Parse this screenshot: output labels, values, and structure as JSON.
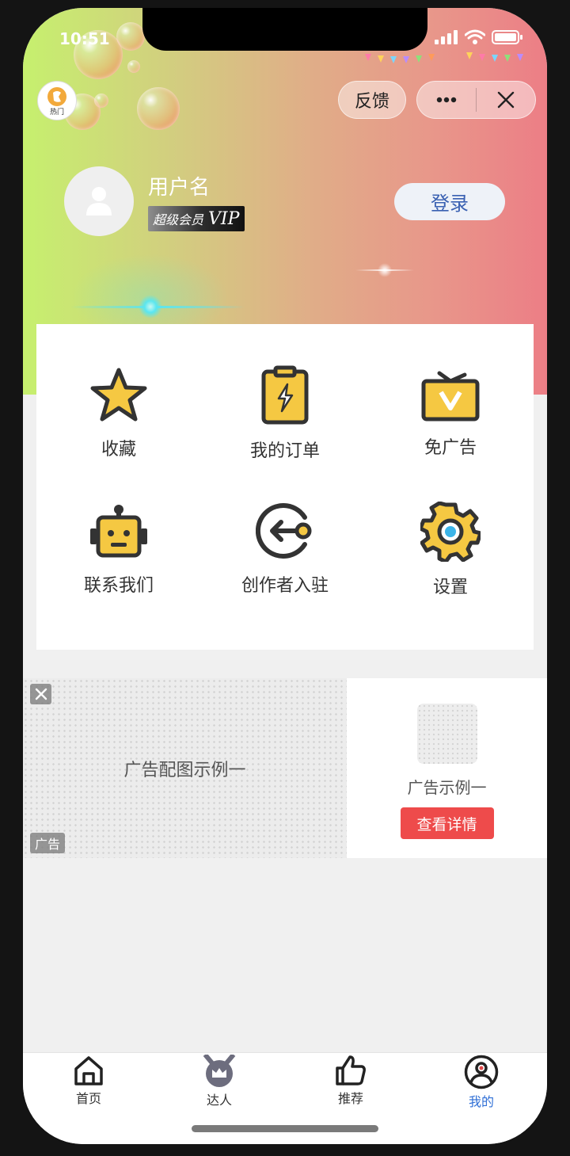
{
  "status_bar": {
    "time": "10:51"
  },
  "header": {
    "logo_text": "热门",
    "feedback_label": "反馈",
    "more_icon": "more-dots-icon",
    "close_icon": "close-icon"
  },
  "profile": {
    "username": "用户名",
    "vip_badge_cn": "超级会员",
    "vip_badge_en": "VIP",
    "login_label": "登录"
  },
  "menu": {
    "items": [
      {
        "label": "收藏",
        "icon": "star-icon"
      },
      {
        "label": "我的订单",
        "icon": "clipboard-lightning-icon"
      },
      {
        "label": "免广告",
        "icon": "tv-v-icon"
      },
      {
        "label": "联系我们",
        "icon": "robot-icon"
      },
      {
        "label": "创作者入驻",
        "icon": "login-circle-icon"
      },
      {
        "label": "设置",
        "icon": "gear-icon"
      }
    ]
  },
  "ad": {
    "image_text": "广告配图示例一",
    "tag": "广告",
    "side_title": "广告示例一",
    "detail_button": "查看详情"
  },
  "tabbar": {
    "items": [
      {
        "label": "首页",
        "icon": "home-icon",
        "active": false
      },
      {
        "label": "达人",
        "icon": "medal-crown-icon",
        "active": false
      },
      {
        "label": "推荐",
        "icon": "thumbs-up-icon",
        "active": false
      },
      {
        "label": "我的",
        "icon": "user-circle-icon",
        "active": true
      }
    ]
  },
  "colors": {
    "accent_blue": "#2f6fd6",
    "login_text": "#3a61b2",
    "icon_yellow": "#f5c842",
    "icon_dark": "#333333",
    "ad_button": "#ee4b4b"
  }
}
